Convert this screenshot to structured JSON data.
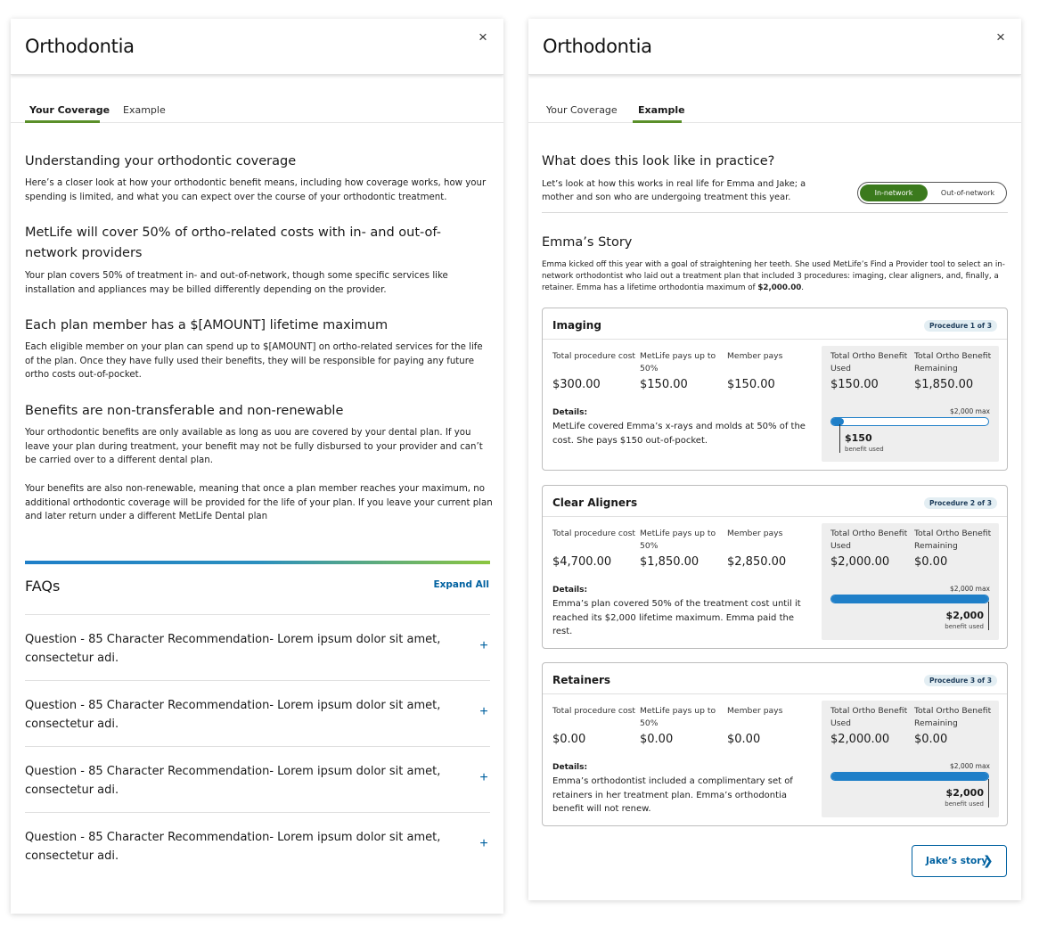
{
  "left": {
    "title": "Orthodontia",
    "close": "×",
    "tabs": [
      "Your Coverage",
      "Example"
    ],
    "sections": [
      {
        "heading": "Understanding your orthodontic coverage",
        "body": "Here’s a closer look at how your orthodontic benefit means, including how coverage works, how your spending is limited, and what you can expect over the course of your orthodontic treatment."
      },
      {
        "heading": "MetLife will cover 50% of ortho-related costs with in- and out-of-network providers",
        "body": "Your plan covers 50% of treatment in- and out-of-network, though some specific services like installation and appliances may be billed differently depending on the provider."
      },
      {
        "heading": "Each plan member has a $[AMOUNT] lifetime maximum",
        "body": "Each eligible member on your plan can spend up to $[AMOUNT] on ortho-related services for the life of the plan. Once they have fully used their benefits, they will be responsible for paying any future ortho costs out-of-pocket."
      },
      {
        "heading": "Benefits are non-transferable and non-renewable",
        "body": "Your orthodontic benefits are only available as long as uou are covered by your dental plan. If you leave your plan during treatment, your benefit may not be fully disbursed to your provider and can’t be carried over to a different dental plan.",
        "body2": "Your benefits are also non-renewable, meaning that once a plan member reaches your maximum, no additional orthodontic coverage will be provided for the life of your plan. If you leave your current plan and later return under a different MetLife Dental plan"
      }
    ],
    "faq": {
      "title": "FAQs",
      "expand_all": "Expand All",
      "items": [
        "Question - 85 Character Recommendation- Lorem ipsum dolor sit amet, consectetur adi.",
        "Question - 85 Character Recommendation- Lorem ipsum dolor sit amet, consectetur adi.",
        "Question - 85 Character Recommendation- Lorem ipsum dolor sit amet, consectetur adi.",
        "Question - 85 Character Recommendation- Lorem ipsum dolor sit amet, consectetur adi."
      ],
      "plus": "+"
    }
  },
  "right": {
    "title": "Orthodontia",
    "close": "×",
    "tabs": [
      "Your Coverage",
      "Example"
    ],
    "practice_heading": "What does this look like in practice?",
    "practice_body": "Let’s look at how this works in real life for Emma and Jake; a mother and son who are undergoing treatment this year.",
    "toggle": {
      "on": "In-network",
      "off": "Out-of-network"
    },
    "story_heading": "Emma’s Story",
    "story_body_pre": "Emma kicked off this year with a goal of straightening her teeth. She used MetLife’s Find a Provider tool to select an in-network orthodontist who laid out a treatment plan that included 3 procedures: imaging, clear aligners, and, finally, a retainer. Emma has a lifetime orthodontia maximum of ",
    "story_body_bold": "$2,000.00",
    "story_body_post": ".",
    "col_labels": {
      "total": "Total procedure cost",
      "metlife": "MetLife pays up to 50%",
      "member": "Member pays",
      "used": "Total Ortho Benefit Used",
      "remaining": "Total Ortho Benefit Remaining"
    },
    "details_label": "Details:",
    "max_label": "$2,000 max",
    "benefit_used_label": "benefit used",
    "procedures": [
      {
        "name": "Imaging",
        "badge": "Procedure 1 of 3",
        "total": "$300.00",
        "metlife": "$150.00",
        "member": "$150.00",
        "used": "$150.00",
        "remaining": "$1,850.00",
        "details": "MetLife covered Emma’s x-rays and molds at 50% of the cost. She pays $150 out-of-pocket.",
        "used_amount": "$150",
        "used_fraction": 0.075
      },
      {
        "name": "Clear Aligners",
        "badge": "Procedure 2 of 3",
        "total": "$4,700.00",
        "metlife": "$1,850.00",
        "member": "$2,850.00",
        "used": "$2,000.00",
        "remaining": "$0.00",
        "details": "Emma’s plan covered 50% of the treatment cost until it reached its $2,000 lifetime maximum. Emma paid the rest.",
        "used_amount": "$2,000",
        "used_fraction": 1.0
      },
      {
        "name": "Retainers",
        "badge": "Procedure 3 of 3",
        "total": "$0.00",
        "metlife": "$0.00",
        "member": "$0.00",
        "used": "$2,000.00",
        "remaining": "$0.00",
        "details": "Emma’s orthodontist included a complimentary set of retainers in her treatment plan. Emma’s orthodontia benefit will not renew.",
        "used_amount": "$2,000",
        "used_fraction": 1.0
      }
    ],
    "next_button": "Jake’s story",
    "next_chevron": "❯",
    "colors": {
      "accent": "#1f7fc8",
      "toggle_on": "#3b7a1d",
      "link": "#0061a0"
    }
  }
}
